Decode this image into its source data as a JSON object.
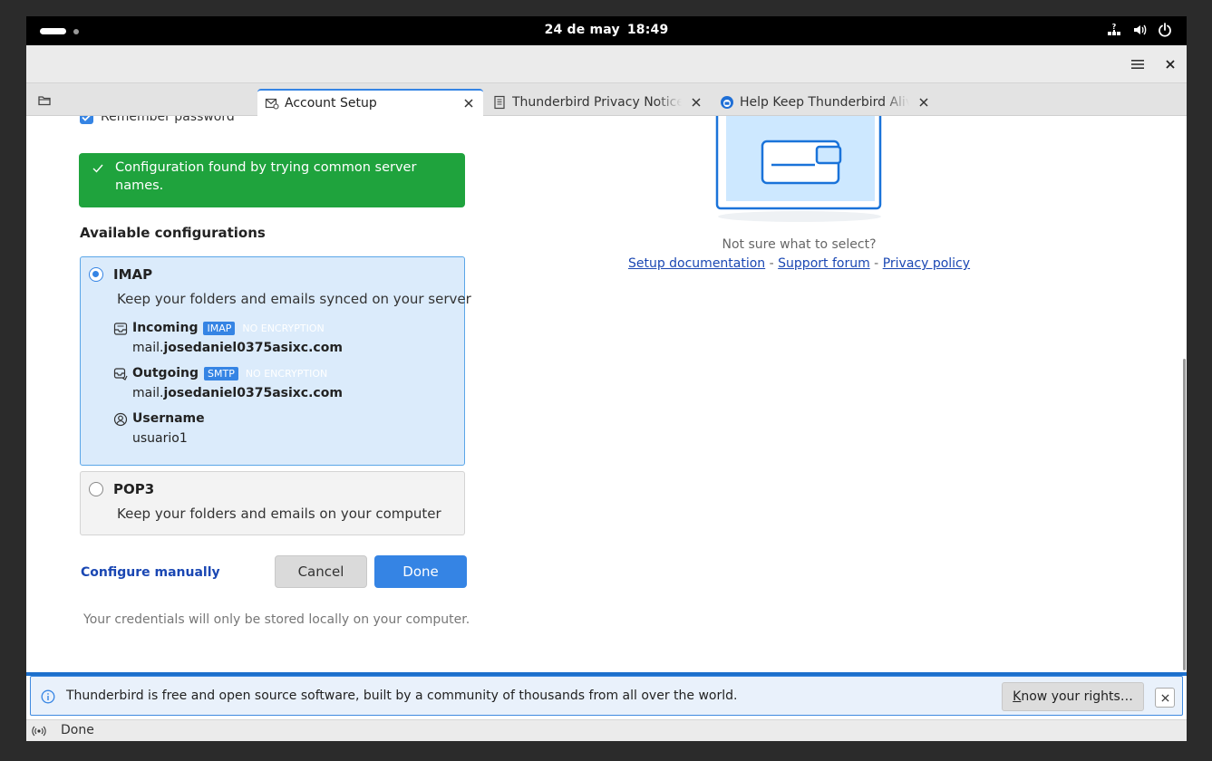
{
  "topbar": {
    "date": "24 de may",
    "time": "18:49"
  },
  "tabs": [
    {
      "title": "Account Setup",
      "icon": "mail-setup-icon"
    },
    {
      "title": "Thunderbird Privacy Notice — ",
      "icon": "document-icon"
    },
    {
      "title": "Help Keep Thunderbird Alive!",
      "icon": "thunderbird-logo-icon"
    }
  ],
  "setup": {
    "remember_password": "Remember password",
    "success_message": "Configuration found by trying common server names.",
    "available_heading": "Available configurations",
    "configs": [
      {
        "title": "IMAP",
        "description": "Keep your folders and emails synced on your server",
        "selected": true
      },
      {
        "title": "POP3",
        "description": "Keep your folders and emails on your computer",
        "selected": false
      }
    ],
    "incoming": {
      "label": "Incoming",
      "protocol": "IMAP",
      "encryption": "NO ENCRYPTION",
      "host_prefix": "mail.",
      "host_domain": "josedaniel0375asixc.com"
    },
    "outgoing": {
      "label": "Outgoing",
      "protocol": "SMTP",
      "encryption": "NO ENCRYPTION",
      "host_prefix": "mail.",
      "host_domain": "josedaniel0375asixc.com"
    },
    "username": {
      "label": "Username",
      "value": "usuario1"
    },
    "configure_manually": "Configure manually",
    "cancel": "Cancel",
    "done": "Done",
    "credentials_note": "Your credentials will only be stored locally on your computer."
  },
  "help": {
    "question": "Not sure what to select?",
    "setup_docs": "Setup documentation",
    "separator": "-",
    "support_forum": "Support forum",
    "privacy_policy": "Privacy policy"
  },
  "notification": {
    "text": "Thunderbird is free and open source software, built by a community of thousands from all over the world.",
    "button_accel": "K",
    "button_rest": "now your rights…"
  },
  "statusbar": {
    "text": "Done"
  },
  "colors": {
    "accent": "#3584e4",
    "success": "#1fa33d",
    "link": "#1a47b3"
  }
}
